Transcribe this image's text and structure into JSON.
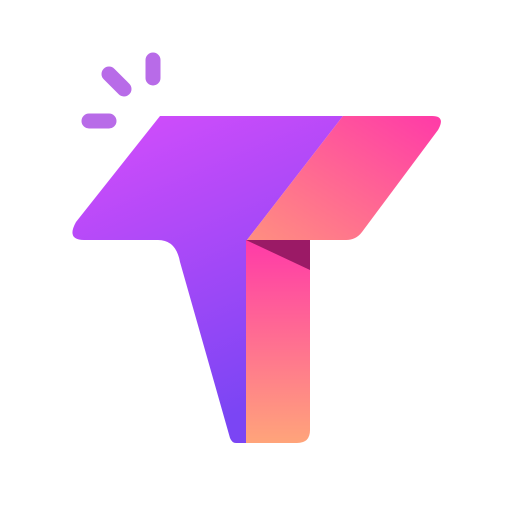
{
  "logo": {
    "icon": "letter-t-logo-icon",
    "spark_icon": "spark-lines-icon",
    "colors": {
      "background": "#ffffff",
      "left_panel_top": "#d64dfb",
      "left_panel_bottom": "#7b45f4",
      "right_fold_top": "#ff3aa8",
      "right_fold_bottom": "#ff8f80",
      "stem_top": "#ff3aa8",
      "stem_bottom": "#ffa47a",
      "fold_shadow": "#9b1a66",
      "spark": "#b86be8"
    }
  }
}
